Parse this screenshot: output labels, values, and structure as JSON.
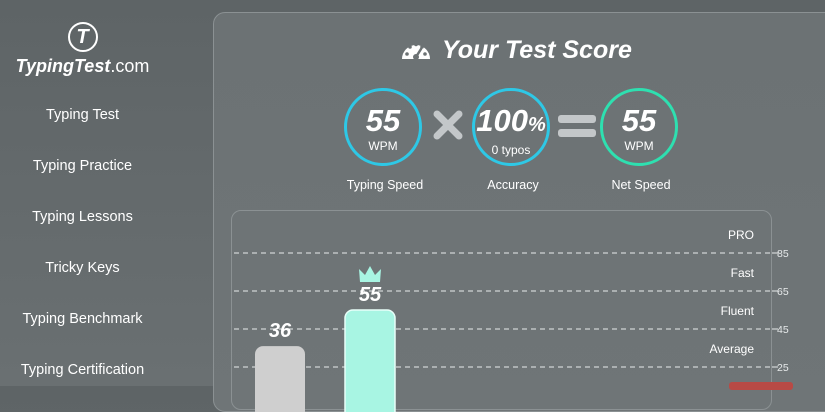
{
  "sidebar": {
    "logo_mark": "T",
    "logo_text_main": "TypingTest",
    "logo_text_suffix": ".com",
    "items": [
      {
        "label": "Typing Test"
      },
      {
        "label": "Typing Practice"
      },
      {
        "label": "Typing Lessons"
      },
      {
        "label": "Tricky Keys"
      },
      {
        "label": "Typing Benchmark"
      },
      {
        "label": "Typing Certification"
      }
    ]
  },
  "score": {
    "title": "Your Test Score",
    "typing_speed": {
      "value": "55",
      "unit": "WPM",
      "caption": "Typing Speed"
    },
    "accuracy": {
      "value": "100",
      "unit_symbol": "%",
      "sub": "0 typos",
      "caption": "Accuracy"
    },
    "net_speed": {
      "value": "55",
      "unit": "WPM",
      "caption": "Net Speed"
    }
  },
  "colors": {
    "accent_blue": "#2ec8e6",
    "accent_green": "#2ee0b0",
    "bar_user": "#a8f5e3",
    "bar_avg": "#cfcfcf"
  },
  "chart_data": {
    "type": "bar",
    "values": [
      36,
      55
    ],
    "labels": [
      "36",
      "55"
    ],
    "highlight_index": 1,
    "crown_on": 1,
    "yticks": [
      25,
      45,
      65,
      85
    ],
    "levels": [
      "Average",
      "Fluent",
      "Fast",
      "PRO"
    ],
    "grid": "dashed"
  }
}
